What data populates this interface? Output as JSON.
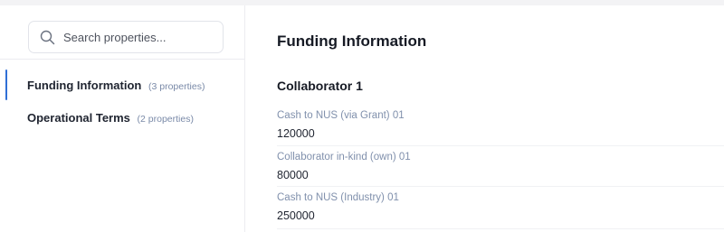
{
  "search": {
    "placeholder": "Search properties..."
  },
  "sidebar": {
    "items": [
      {
        "label": "Funding Information",
        "count": "(3 properties)",
        "active": true
      },
      {
        "label": "Operational Terms",
        "count": "(2 properties)",
        "active": false
      }
    ]
  },
  "main": {
    "title": "Funding Information",
    "section": "Collaborator 1",
    "properties": [
      {
        "label": "Cash to NUS (via Grant) 01",
        "value": "120000"
      },
      {
        "label": "Collaborator in-kind (own) 01",
        "value": "80000"
      },
      {
        "label": "Cash to NUS (Industry) 01",
        "value": "250000"
      }
    ]
  },
  "colors": {
    "accent": "#2f6fd6",
    "muted_label": "#8090ac",
    "text": "#1f2430"
  }
}
